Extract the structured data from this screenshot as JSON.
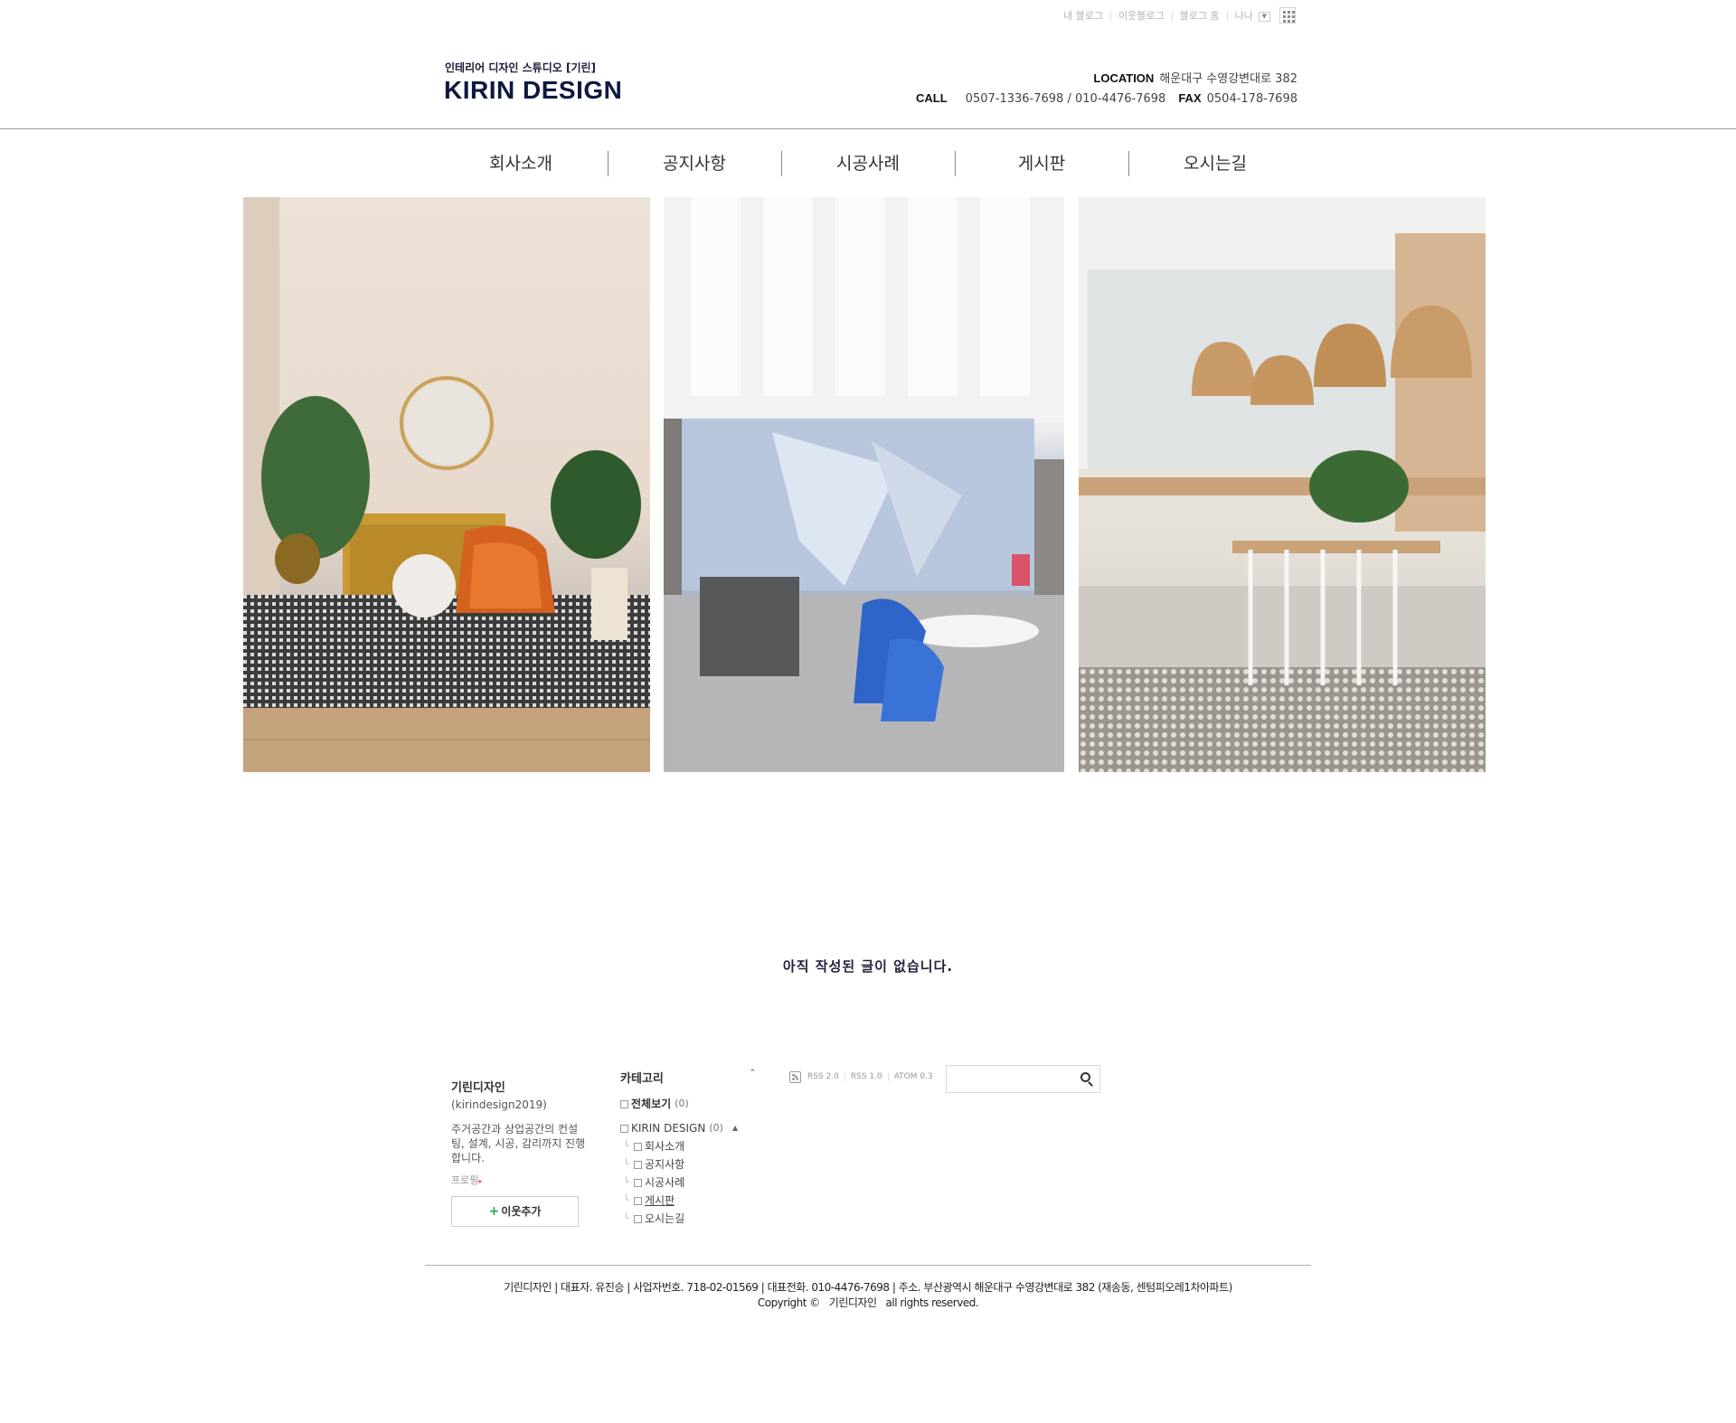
{
  "util": {
    "links": [
      "내 블로그",
      "이웃블로그",
      "블로그 홈"
    ],
    "nickname": "나나",
    "dropdown": "▼",
    "grid_icon": "apps-grid-icon"
  },
  "header": {
    "subtitle": "인테리어 디자인 스튜디오 [기린]",
    "brand": "KIRIN DESIGN",
    "location_label": "LOCATION",
    "location_value": "해운대구 수영강변대로 382",
    "call_label": "CALL",
    "call_value": "0507-1336-7698 / 010-4476-7698",
    "fax_label": "FAX",
    "fax_value": "0504-178-7698"
  },
  "nav": {
    "items": [
      "회사소개",
      "공지사항",
      "시공사례",
      "게시판",
      "오시는길"
    ]
  },
  "main": {
    "empty_message": "아직 작성된 글이 없습니다."
  },
  "profile": {
    "name": "기린디자인",
    "id": "(kirindesign2019)",
    "desc": "주거공간과 상업공간의 컨설팅, 설계, 시공, 감리까지 진행합니다.",
    "link": "프로필",
    "link_arrow": "▸",
    "add_button": "이웃추가",
    "add_plus": "+"
  },
  "category": {
    "title": "카테고리",
    "collapse": "⌃",
    "all_label": "전체보기",
    "all_count": "(0)",
    "group_label": "KIRIN DESIGN",
    "group_count": "(0)",
    "group_toggle": "▲",
    "tree_glyph": "└",
    "items": [
      "회사소개",
      "공지사항",
      "시공사례",
      "게시판",
      "오시는길"
    ]
  },
  "rss": {
    "links": [
      "RSS 2.0",
      "RSS 1.0",
      "ATOM 0.3"
    ]
  },
  "search": {
    "placeholder": ""
  },
  "footer": {
    "info": "기린디자인 | 대표자. 유진승 | 사업자번호. 718-02-01569 | 대표전화. 010-4476-7698 | 주소. 부산광역시 해운대구 수영강변대로 382 (재송동, 센텀피오레1차아파트)",
    "copyright": "Copyright ©",
    "company": "기린디자인",
    "rights": "all rights reserved."
  }
}
